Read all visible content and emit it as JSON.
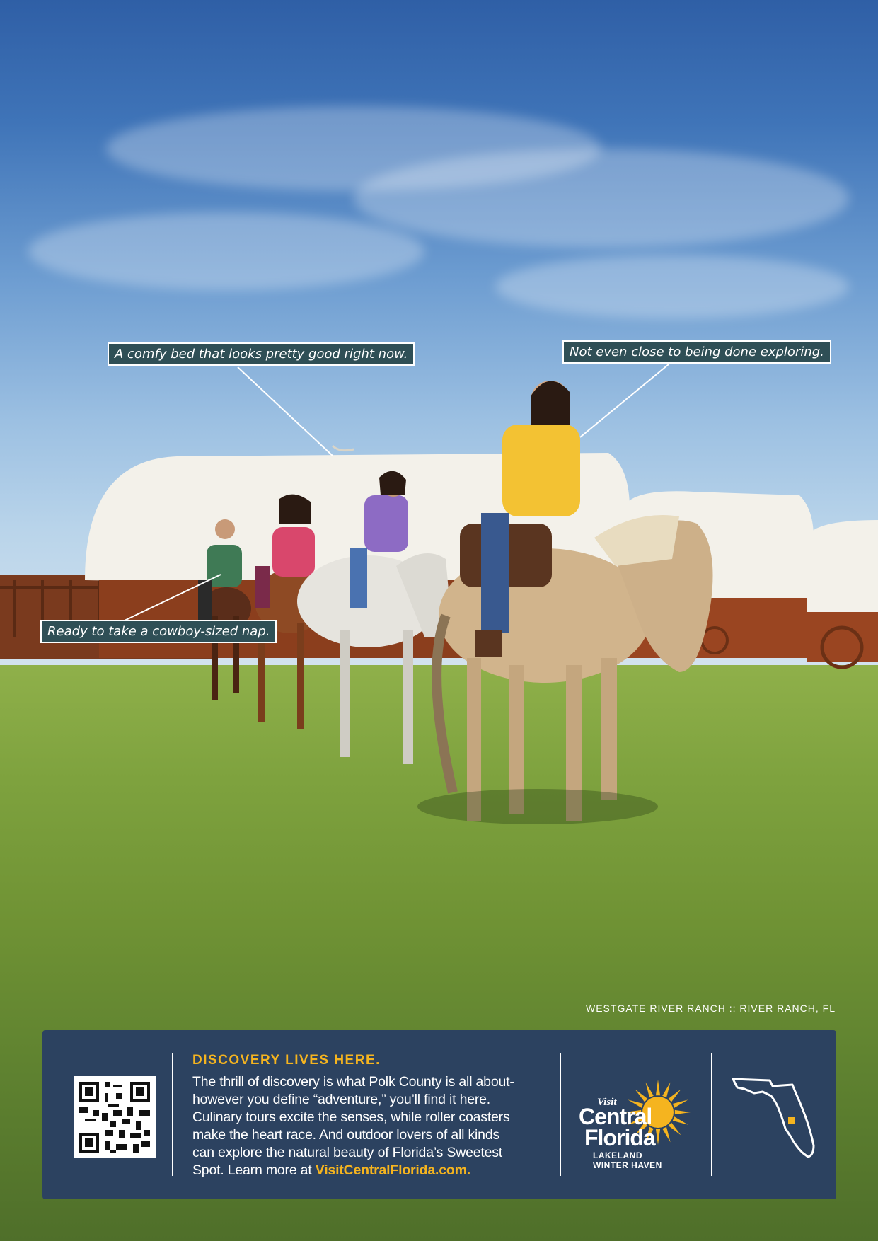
{
  "photo": {
    "description_icon": "horseback-riders-photo"
  },
  "callouts": {
    "bed": "A comfy bed that looks pretty good right now.",
    "exploring": "Not even close to being done exploring.",
    "nap": "Ready to take a cowboy-sized nap."
  },
  "credit": "WESTGATE RIVER RANCH  ::  RIVER RANCH, FL",
  "panel": {
    "headline": "DISCOVERY LIVES HERE.",
    "body_lines": [
      "The thrill of discovery is what Polk County is all about-",
      "however you define “adventure,” you’ll find it here.",
      "Culinary tours excite the senses, while roller coasters",
      "make the heart race. And outdoor lovers of all kinds",
      "can explore the natural beauty of Florida’s Sweetest"
    ],
    "last_line_prefix": "Spot. Learn more at ",
    "link": "VisitCentralFlorida.com."
  },
  "logo": {
    "visit": "Visit",
    "central": "Central",
    "florida": "Florida",
    "sub1": "LAKELAND",
    "sub2": "WINTER HAVEN"
  },
  "colors": {
    "panel": "#2c4260",
    "accent": "#f5b41f",
    "callout_bg": "#2f4f56"
  }
}
